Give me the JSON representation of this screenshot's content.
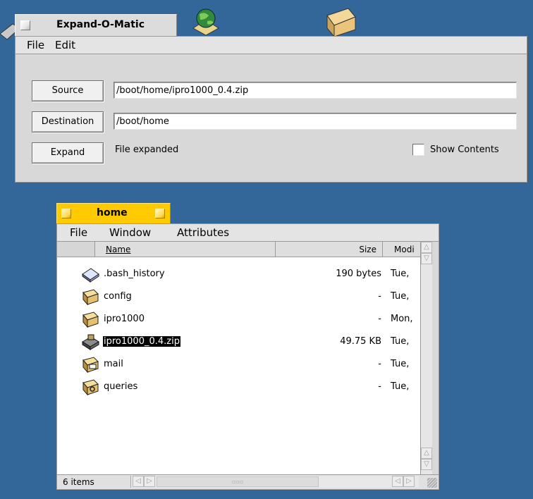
{
  "colors": {
    "desktop": "#33679a",
    "tab_active": "#ffcb00",
    "selection": "#000000"
  },
  "expander": {
    "title": "Expand-O-Matic",
    "menu": [
      "File",
      "Edit"
    ],
    "source_label": "Source",
    "source_value": "/boot/home/ipro1000_0.4.zip",
    "destination_label": "Destination",
    "destination_value": "/boot/home",
    "expand_label": "Expand",
    "status": "File expanded",
    "show_contents_label": "Show Contents",
    "show_contents_checked": false
  },
  "tracker": {
    "title": "home",
    "menu": [
      "File",
      "Window",
      "Attributes"
    ],
    "columns": {
      "name": "Name",
      "size": "Size",
      "modified": "Modi"
    },
    "rows": [
      {
        "icon": "text-file-icon",
        "name": ".bash_history",
        "size": "190 bytes",
        "modified": "Tue,",
        "selected": false
      },
      {
        "icon": "folder-icon",
        "name": "config",
        "size": "-",
        "modified": "Tue,",
        "selected": false
      },
      {
        "icon": "folder-icon",
        "name": "ipro1000",
        "size": "-",
        "modified": "Mon,",
        "selected": false
      },
      {
        "icon": "zip-archive-icon",
        "name": "ipro1000_0.4.zip",
        "size": "49.75 KB",
        "modified": "Tue,",
        "selected": true
      },
      {
        "icon": "mail-folder-icon",
        "name": "mail",
        "size": "-",
        "modified": "Tue,",
        "selected": false
      },
      {
        "icon": "queries-folder-icon",
        "name": "queries",
        "size": "-",
        "modified": "Tue,",
        "selected": false
      }
    ],
    "status_count": "6 items"
  }
}
